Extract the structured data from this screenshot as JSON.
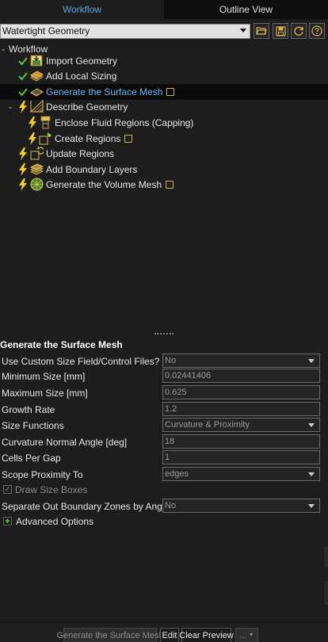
{
  "tabs": {
    "workflow": "Workflow",
    "outline": "Outline View"
  },
  "toolbar": {
    "workflow_type": "Watertight Geometry"
  },
  "tree": {
    "root_label": "Workflow",
    "items": [
      {
        "label": "Import Geometry"
      },
      {
        "label": "Add Local Sizing"
      },
      {
        "label": "Generate the Surface Mesh"
      },
      {
        "label": "Describe Geometry"
      },
      {
        "label": "Enclose Fluid Regions (Capping)"
      },
      {
        "label": "Create Regions"
      },
      {
        "label": "Update Regions"
      },
      {
        "label": "Add Boundary Layers"
      },
      {
        "label": "Generate the Volume Mesh"
      }
    ]
  },
  "panel": {
    "title": "Generate the Surface Mesh",
    "fields": [
      {
        "label": "Use Custom Size Field/Control Files?",
        "value": "No"
      },
      {
        "label": "Minimum Size [mm]",
        "value": "0.02441406"
      },
      {
        "label": "Maximum Size [mm]",
        "value": "0.625"
      },
      {
        "label": "Growth Rate",
        "value": "1.2"
      },
      {
        "label": "Size Functions",
        "value": "Curvature & Proximity"
      },
      {
        "label": "Curvature Normal Angle [deg]",
        "value": "18"
      },
      {
        "label": "Cells Per Gap",
        "value": "1"
      },
      {
        "label": "Scope Proximity To",
        "value": "edges"
      }
    ],
    "draw_size_boxes": "Draw Size Boxes",
    "separate_zones": {
      "label": "Separate Out Boundary Zones by Angle?",
      "value": "No"
    },
    "advanced": "Advanced Options"
  },
  "footer": {
    "generate": "Generate the Surface Mesh",
    "edit": "Edit",
    "clear": "Clear Preview",
    "more": "..."
  },
  "colors": {
    "accent": "#5ba4e6",
    "check": "#5fc43a",
    "bolt": "#f2d21b",
    "note": "#d9b24a"
  }
}
